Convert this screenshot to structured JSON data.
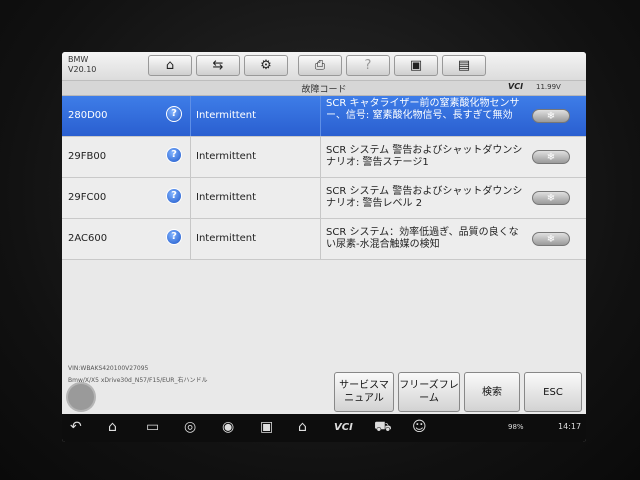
{
  "header": {
    "brand": "BMW",
    "version": "V20.10",
    "subtitle": "故障コード",
    "vci": "VCI",
    "battery": "11.99V"
  },
  "toolbar": [
    {
      "icon": "home-icon",
      "glyph": "⌂"
    },
    {
      "icon": "vehicle-swap-icon",
      "glyph": "⇆"
    },
    {
      "icon": "gear-icon",
      "glyph": "⚙"
    },
    {
      "icon": "printer-icon",
      "glyph": "⎙"
    },
    {
      "icon": "help-icon",
      "glyph": "?"
    },
    {
      "icon": "save-icon",
      "glyph": "▣"
    },
    {
      "icon": "message-icon",
      "glyph": "▤"
    }
  ],
  "dtcs": [
    {
      "code": "280D00",
      "status": "Intermittent",
      "description": "SCR キャタライザー前の窒素酸化物センサー、信号: 窒素酸化物信号、長すぎて無効",
      "selected": true
    },
    {
      "code": "29FB00",
      "status": "Intermittent",
      "description": "SCR システム 警告およびシャットダウンシナリオ: 警告ステージ1",
      "selected": false
    },
    {
      "code": "29FC00",
      "status": "Intermittent",
      "description": "SCR システム 警告およびシャットダウンシナリオ: 警告レベル 2",
      "selected": false
    },
    {
      "code": "2AC600",
      "status": "Intermittent",
      "description": "SCR システム：効率低過ぎ、品質の良くない尿素-水混合触媒の検知",
      "selected": false
    }
  ],
  "footer": {
    "vin": "VIN:WBAKS420100V27095",
    "vehicle_path": "Bmw/X/X5 xDrive30d_N57/F15/EUR_右ハンドル",
    "buttons": [
      "サービスマニュアル",
      "フリーズフレーム",
      "検索",
      "ESC"
    ]
  },
  "navbar": {
    "status": "98%",
    "time": "14:17"
  },
  "colors": {
    "selected_row": "#2a5fd0",
    "background": "#e9e9e9"
  }
}
